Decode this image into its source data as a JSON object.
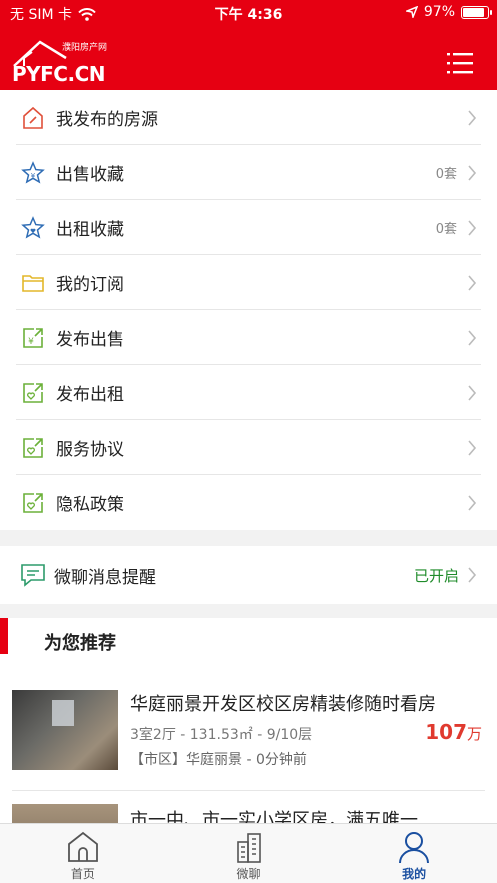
{
  "status_bar": {
    "carrier": "无 SIM 卡",
    "time": "下午 4:36",
    "battery": "97%",
    "battery_level": 0.97
  },
  "header": {
    "logo_small": "濮阳房产网",
    "logo_big": "PYFC.CN",
    "menu_icon": "list-menu-icon"
  },
  "menu": [
    {
      "label": "我发布的房源",
      "icon": "house-edit-icon",
      "meta": ""
    },
    {
      "label": "出售收藏",
      "icon": "star-yen-icon",
      "meta": "0套"
    },
    {
      "label": "出租收藏",
      "icon": "star-heart-icon",
      "meta": "0套"
    },
    {
      "label": "我的订阅",
      "icon": "folder-icon",
      "meta": ""
    },
    {
      "label": "发布出售",
      "icon": "share-yen-icon",
      "meta": ""
    },
    {
      "label": "发布出租",
      "icon": "share-heart-icon",
      "meta": ""
    },
    {
      "label": "服务协议",
      "icon": "share-heart-icon",
      "meta": ""
    },
    {
      "label": "隐私政策",
      "icon": "share-heart-icon",
      "meta": ""
    }
  ],
  "message": {
    "label": "微聊消息提醒",
    "status": "已开启"
  },
  "recommend": {
    "title": "为您推荐",
    "items": [
      {
        "title": "华庭丽景开发区校区房精装修随时看房",
        "spec": "3室2厅 - 131.53㎡ - 9/10层",
        "price": "107",
        "unit": "万",
        "location": "【市区】华庭丽景 - 0分钟前"
      },
      {
        "title": "市一中、市一实小学区房，满五唯一"
      }
    ]
  },
  "tabs": [
    {
      "label": "首页",
      "icon": "home-icon",
      "active": false
    },
    {
      "label": "微聊",
      "icon": "buildings-icon",
      "active": false
    },
    {
      "label": "我的",
      "icon": "user-icon",
      "active": true
    }
  ],
  "colors": {
    "brand_red": "#e60012",
    "accent_blue": "#1a4fa0",
    "status_green": "#1f8b2a",
    "price_red": "#e03a2f"
  }
}
